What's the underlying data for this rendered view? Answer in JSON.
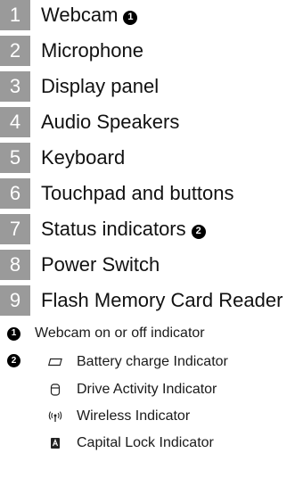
{
  "components": [
    {
      "number": "1",
      "label": "Webcam",
      "note": "1"
    },
    {
      "number": "2",
      "label": "Microphone"
    },
    {
      "number": "3",
      "label": "Display panel"
    },
    {
      "number": "4",
      "label": "Audio Speakers"
    },
    {
      "number": "5",
      "label": "Keyboard"
    },
    {
      "number": "6",
      "label": "Touchpad and buttons"
    },
    {
      "number": "7",
      "label": "Status indicators",
      "note": "2"
    },
    {
      "number": "8",
      "label": "Power Switch"
    },
    {
      "number": "9",
      "label": "Flash Memory Card Reader"
    }
  ],
  "notes": {
    "note1": {
      "badge": "1",
      "text": "Webcam on or off indicator"
    },
    "note2": {
      "badge": "2"
    }
  },
  "indicators": [
    {
      "icon": "battery-icon",
      "label": "Battery charge Indicator"
    },
    {
      "icon": "drive-icon",
      "label": "Drive Activity Indicator"
    },
    {
      "icon": "wireless-icon",
      "label": "Wireless Indicator"
    },
    {
      "icon": "caps-lock-icon",
      "label": "Capital Lock Indicator"
    }
  ],
  "colors": {
    "number_box": "#9a9a9a",
    "text": "#1a1a1a"
  }
}
